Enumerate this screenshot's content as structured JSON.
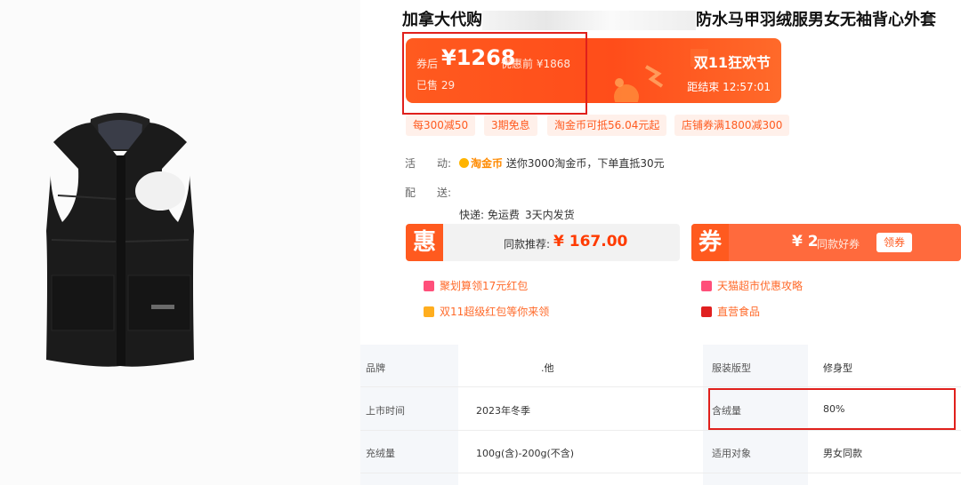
{
  "product": {
    "title_prefix": "加拿大代购",
    "title_suffix": "防水马甲羽绒服男女无袖背心外套"
  },
  "promo": {
    "price_after_label": "券后",
    "price_after_value": "¥1268",
    "price_before": "优惠前 ¥1868",
    "sold": "已售 29",
    "festival": "双11狂欢节",
    "countdown": "距结束 12:57:01"
  },
  "tags": [
    "每300减50",
    "3期免息",
    "淘金币可抵56.04元起",
    "店铺券满1800减300"
  ],
  "activity": {
    "label": "活　　动:",
    "brand": "淘金币",
    "text": "送你3000淘金币，下单直抵30元"
  },
  "delivery": {
    "label": "配　　送:",
    "express": "快递: 免运费",
    "ship_time": "3天内发货"
  },
  "deal_left": {
    "badge": "惠",
    "label": "同款推荐:",
    "price": "¥ 167.00"
  },
  "deal_right": {
    "badge": "券",
    "price": "¥ 2",
    "label": "同款好券",
    "claim": "领券"
  },
  "links": [
    "聚划算领17元红包",
    "天猫超市优惠攻略",
    "双11超级红包等你来领",
    "直营食品"
  ],
  "attributes": {
    "rows": [
      {
        "k1": "品牌",
        "v1": ".他",
        "k2": "服装版型",
        "v2": "修身型"
      },
      {
        "k1": "上市时间",
        "v1": "2023年冬季",
        "k2": "含绒量",
        "v2": "80%"
      },
      {
        "k1": "充绒量",
        "v1": "100g(含)-200g(不含)",
        "k2": "适用对象",
        "v2": "男女同款"
      }
    ]
  },
  "colors": {
    "accent": "#ff5a1f",
    "highlight": "#e0201c"
  }
}
